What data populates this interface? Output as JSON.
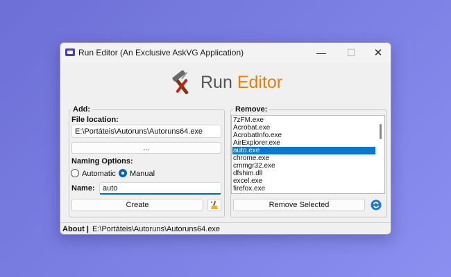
{
  "window": {
    "title": "Run Editor (An Exclusive AskVG Application)",
    "controls": {
      "minimize": "—",
      "maximize": "☐",
      "close": "✕"
    }
  },
  "logo": {
    "word1": "Run",
    "word2": "Editor"
  },
  "add": {
    "legend": "Add:",
    "file_location_label": "File location:",
    "file_location_value": "E:\\Portáteis\\Autoruns\\Autoruns64.exe",
    "browse_label": "...",
    "naming_options_label": "Naming Options:",
    "option_automatic": "Automatic",
    "option_manual": "Manual",
    "selected_option": "Manual",
    "name_label": "Name:",
    "name_value": "auto",
    "create_label": "Create"
  },
  "remove": {
    "legend": "Remove:",
    "items": [
      "7zFM.exe",
      "Acrobat.exe",
      "AcrobatInfo.exe",
      "AirExplorer.exe",
      "auto.exe",
      "chrome.exe",
      "cmmgr32.exe",
      "dfshim.dll",
      "excel.exe",
      "firefox.exe"
    ],
    "selected_item": "auto.exe",
    "remove_selected_label": "Remove Selected"
  },
  "status": {
    "about": "About |",
    "path": "E:\\Portáteis\\Autoruns\\Autoruns64.exe"
  },
  "colors": {
    "accent": "#0067c0",
    "selection": "#0078d7",
    "logo_accent": "#e07f10"
  }
}
